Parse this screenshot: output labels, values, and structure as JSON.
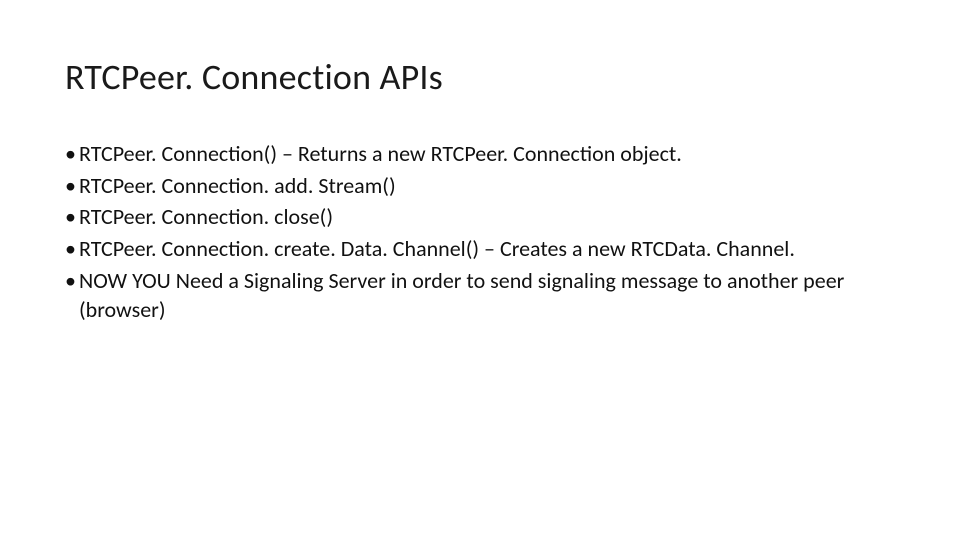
{
  "slide": {
    "title": "RTCPeer. Connection APIs",
    "bullets": [
      "RTCPeer. Connection() – Returns a new RTCPeer. Connection object.",
      "RTCPeer. Connection. add. Stream()",
      "RTCPeer. Connection. close()",
      "RTCPeer. Connection. create. Data. Channel() – Creates a new RTCData. Channel.",
      "NOW YOU Need a Signaling Server in order to send signaling message to another peer (browser)"
    ]
  }
}
